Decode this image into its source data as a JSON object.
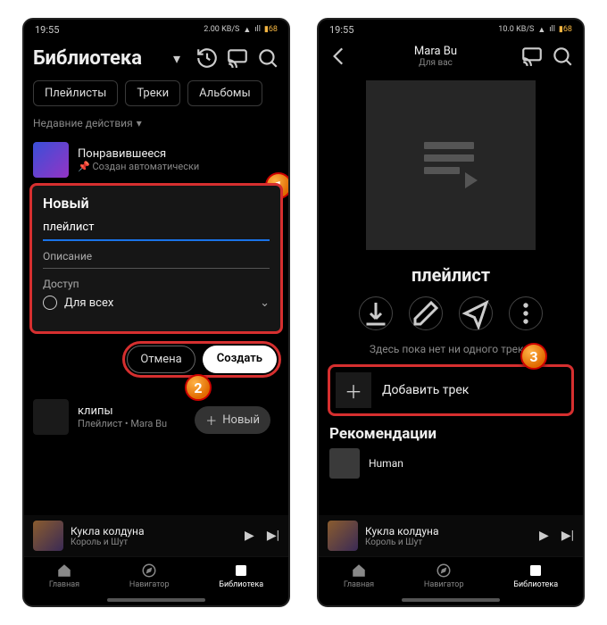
{
  "status": {
    "time": "19:55",
    "net": "2.00 KB/S",
    "net2": "10.0 KB/S",
    "battery": "68"
  },
  "left": {
    "header": {
      "title": "Библиотека"
    },
    "chips": [
      "Плейлисты",
      "Треки",
      "Альбомы"
    ],
    "recent": "Недавние действия",
    "liked": {
      "title": "Понравившееся",
      "sub": "Создан автоматически"
    },
    "modal": {
      "title": "Новый",
      "name_label": "плейлист",
      "desc_label": "Описание",
      "access_label": "Доступ",
      "access_value": "Для всех",
      "cancel": "Отмена",
      "create": "Создать"
    },
    "clips": {
      "title": "клипы",
      "sub": "Плейлист • Mara Bu"
    },
    "new_btn": "Новый",
    "now_playing": {
      "title": "Кукла колдуна",
      "artist": "Король и Шут"
    },
    "nav": {
      "home": "Главная",
      "explore": "Навигатор",
      "library": "Библиотека"
    }
  },
  "right": {
    "header": {
      "user": "Mara Bu",
      "sub": "Для вас"
    },
    "playlist_name": "плейлист",
    "empty": "Здесь пока нет ни одного трека.",
    "add_track": "Добавить трек",
    "reco_title": "Рекомендации",
    "reco_item": "Human",
    "now_playing": {
      "title": "Кукла колдуна",
      "artist": "Король и Шут"
    },
    "nav": {
      "home": "Главная",
      "explore": "Навигатор",
      "library": "Библиотека"
    }
  },
  "markers": {
    "m1": "1",
    "m2": "2",
    "m3": "3"
  }
}
